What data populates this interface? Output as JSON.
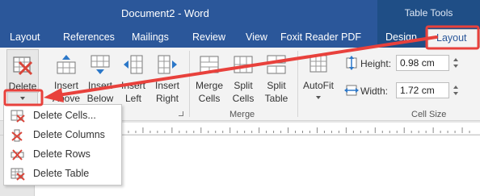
{
  "window": {
    "title": "Document2 - Word",
    "contextual_group": "Table Tools"
  },
  "tabs": [
    {
      "label": "Layout"
    },
    {
      "label": "References"
    },
    {
      "label": "Mailings"
    },
    {
      "label": "Review"
    },
    {
      "label": "View"
    },
    {
      "label": "Foxit Reader PDF"
    },
    {
      "label": "Design"
    },
    {
      "label": "Layout"
    }
  ],
  "ribbon": {
    "delete": {
      "line1": "Delete"
    },
    "insert_above": {
      "line1": "Insert",
      "line2": "Above"
    },
    "insert_below": {
      "line1": "Insert",
      "line2": "Below"
    },
    "insert_left": {
      "line1": "Insert",
      "line2": "Left"
    },
    "insert_right": {
      "line1": "Insert",
      "line2": "Right"
    },
    "merge_cells": {
      "line1": "Merge",
      "line2": "Cells"
    },
    "split_cells": {
      "line1": "Split",
      "line2": "Cells"
    },
    "split_table": {
      "line1": "Split",
      "line2": "Table"
    },
    "autofit": {
      "line1": "AutoFit"
    },
    "groups": {
      "rows_cols_fragment": "s",
      "merge": "Merge",
      "cell_size": "Cell Size"
    },
    "cell_size": {
      "height_label": "Height:",
      "height_value": "0.98 cm",
      "width_label": "Width:",
      "width_value": "1.72 cm"
    }
  },
  "delete_menu": {
    "items": [
      {
        "label": "Delete Cells..."
      },
      {
        "label": "Delete Columns"
      },
      {
        "label": "Delete Rows"
      },
      {
        "label": "Delete Table"
      }
    ]
  },
  "colors": {
    "title_bar": "#2b579a",
    "contextual_tab": "#1f4e86",
    "ribbon_bg": "#f3f3f3",
    "annotation_red": "#e8413c",
    "delete_x_red": "#d9453a"
  },
  "icons": {
    "delete": "delete-table-icon",
    "insert_above": "insert-above-icon",
    "insert_below": "insert-below-icon",
    "insert_left": "insert-left-icon",
    "insert_right": "insert-right-icon",
    "merge_cells": "merge-cells-icon",
    "split_cells": "split-cells-icon",
    "split_table": "split-table-icon",
    "autofit": "autofit-icon",
    "height": "row-height-icon",
    "width": "column-width-icon"
  }
}
